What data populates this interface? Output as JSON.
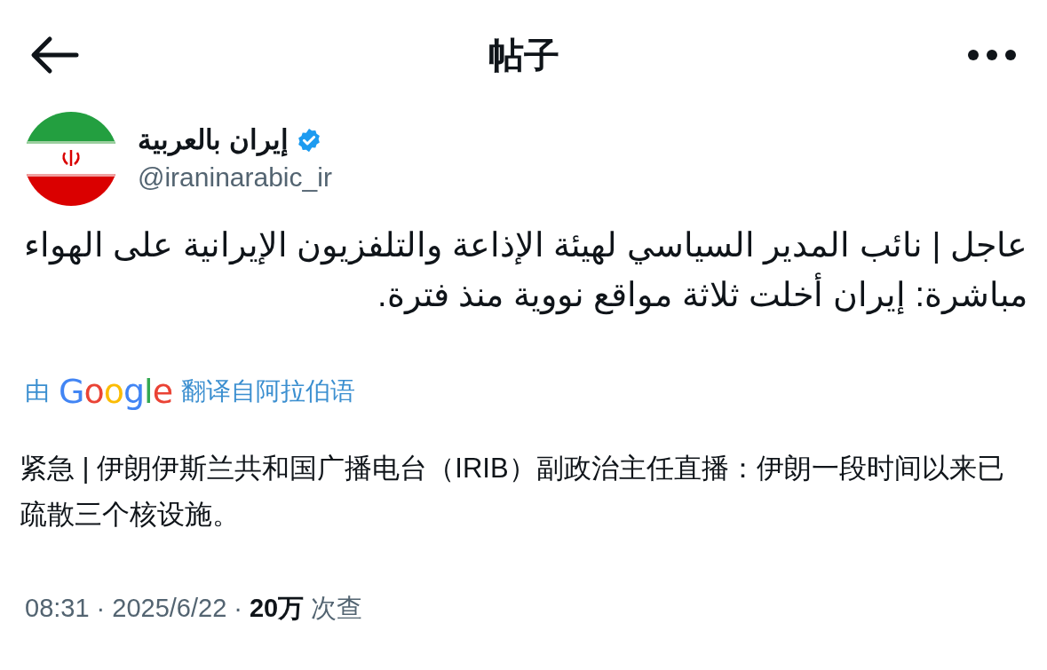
{
  "header": {
    "title": "帖子"
  },
  "post": {
    "author": {
      "name": "إيران بالعربية",
      "verified": true,
      "handle": "@iraninarabic_ir"
    },
    "text": "عاجل | نائب المدير السياسي لهيئة الإذاعة والتلفزيون الإيرانية على الهواء مباشرة: إيران أخلت ثلاثة مواقع نووية منذ فترة.",
    "translation": {
      "prefix": "由",
      "provider": "Google",
      "suffix": "翻译自阿拉伯语"
    },
    "translated_text": "紧急 | 伊朗伊斯兰共和国广播电台（IRIB）副政治主任直播：伊朗一段时间以来已疏散三个核设施。",
    "meta": {
      "time": "08:31",
      "separator": "·",
      "date": "2025/6/22",
      "views_count": "20万",
      "views_label": "次查"
    }
  }
}
